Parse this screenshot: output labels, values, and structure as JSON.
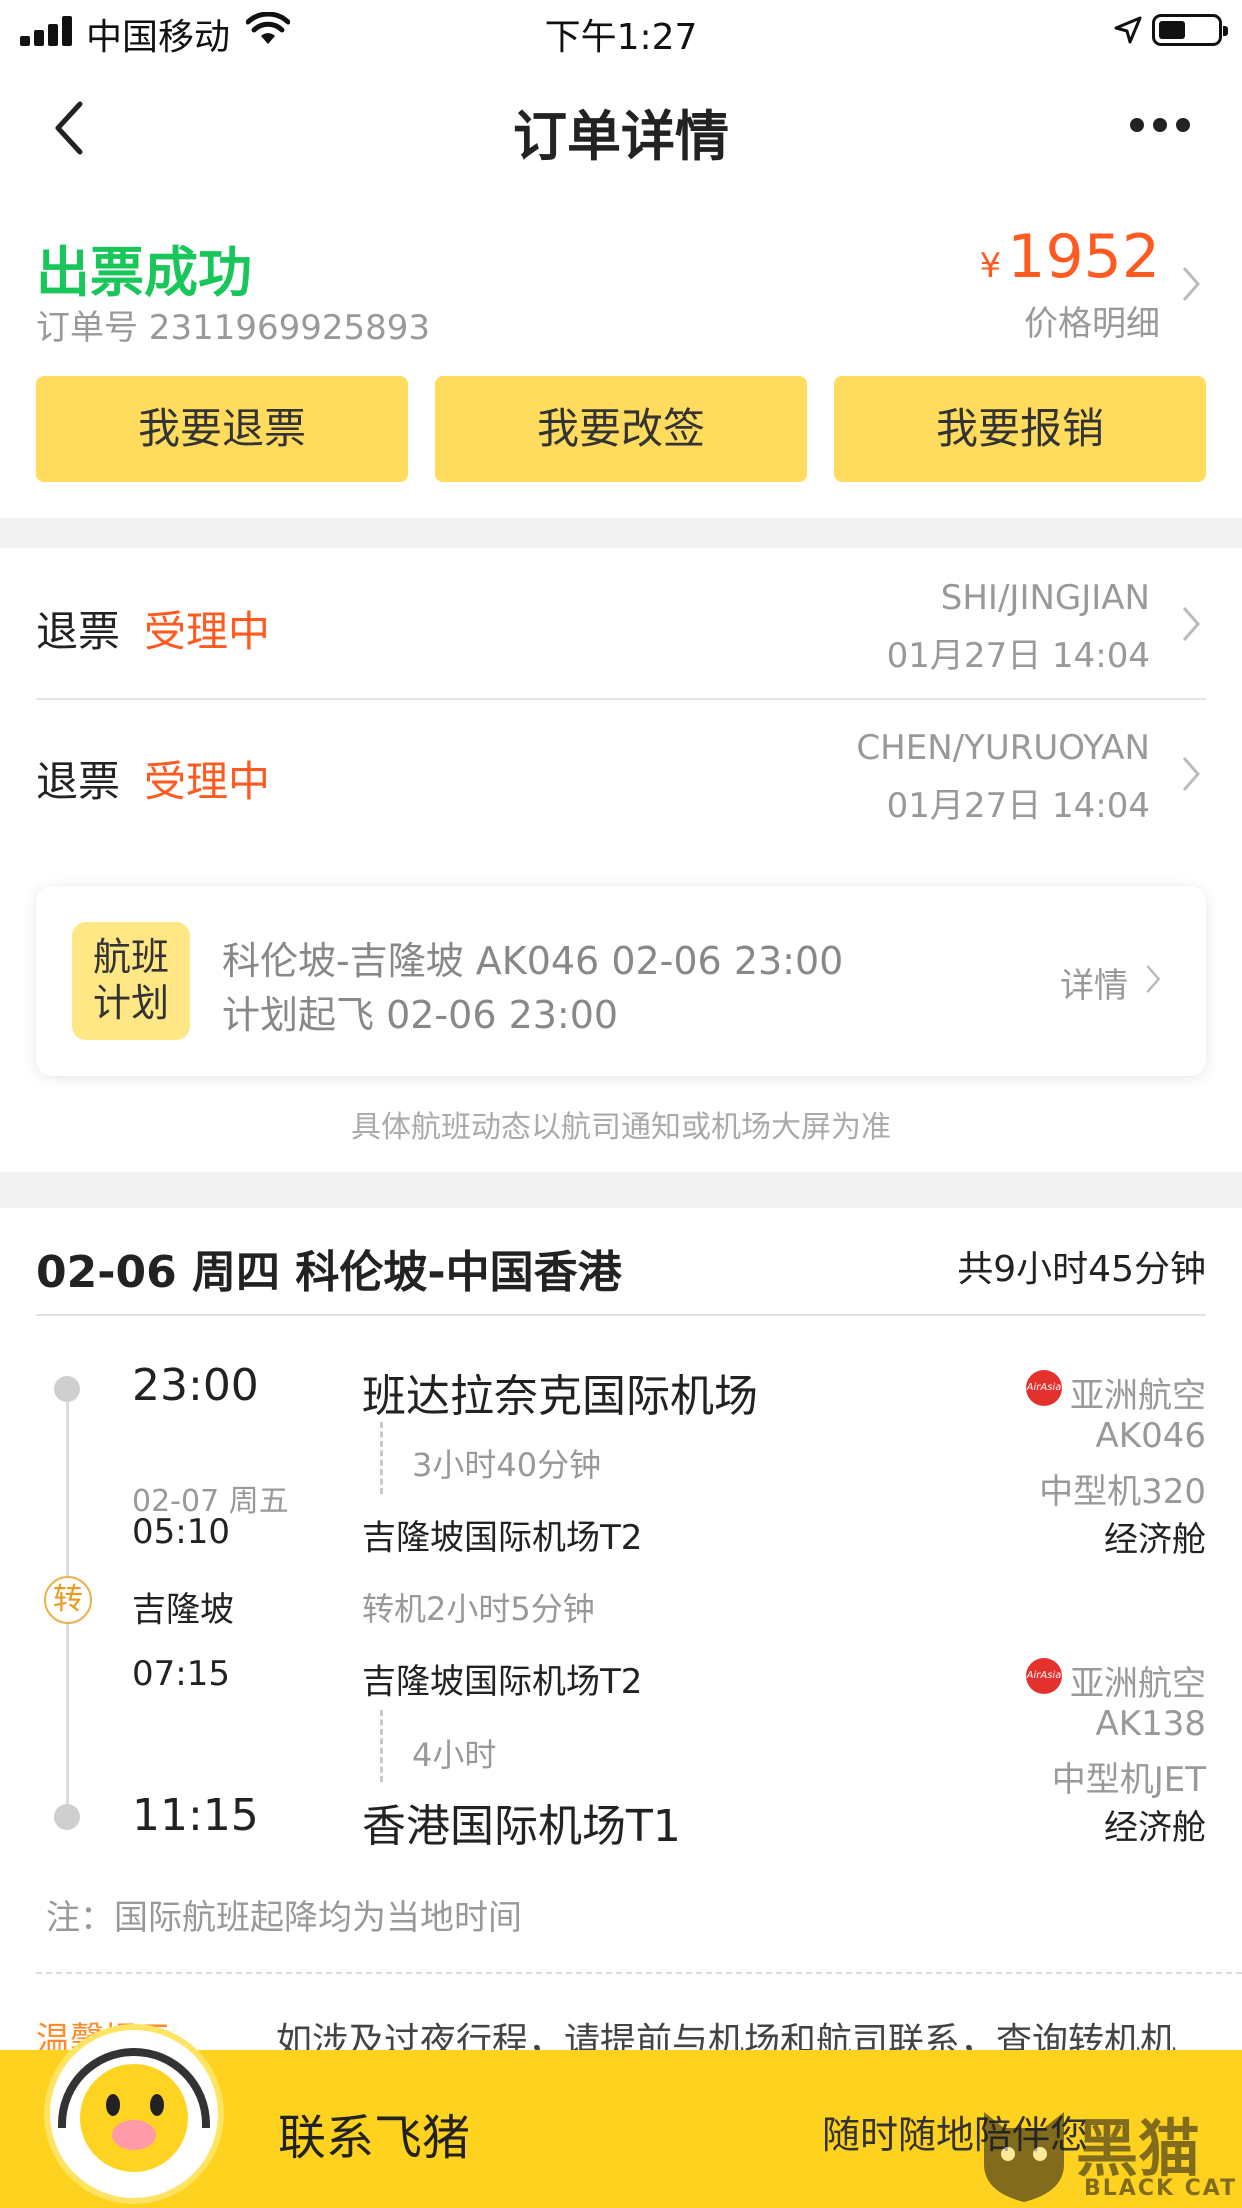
{
  "status_bar": {
    "carrier": "中国移动",
    "time": "下午1:27"
  },
  "nav": {
    "title": "订单详情"
  },
  "order": {
    "status": "出票成功",
    "order_number": "订单号 2311969925893",
    "currency": "¥",
    "price": "1952",
    "price_detail_label": "价格明细"
  },
  "actions": [
    {
      "label": "我要退票"
    },
    {
      "label": "我要改签"
    },
    {
      "label": "我要报销"
    }
  ],
  "refunds": [
    {
      "label": "退票",
      "status": "受理中",
      "passenger": "SHI/JINGJIAN",
      "time": "01月27日 14:04"
    },
    {
      "label": "退票",
      "status": "受理中",
      "passenger": "CHEN/YURUOYAN",
      "time": "01月27日 14:04"
    }
  ],
  "flight_plan": {
    "badge": [
      "航班",
      "计划"
    ],
    "line1": "科伦坡-吉隆坡 AK046 02-06 23:00",
    "line2": "计划起飞 02-06 23:00",
    "detail": "详情",
    "note": "具体航班动态以航司通知或机场大屏为准"
  },
  "itinerary": {
    "title": "02-06 周四 科伦坡-中国香港",
    "total": "共9小时45分钟",
    "transfer_badge": "转",
    "segments": [
      {
        "dep_time": "23:00",
        "dep_airport": "班达拉奈克国际机场",
        "duration": "3小时40分钟",
        "arr_date": "02-07 周五",
        "arr_time": "05:10",
        "arr_airport": "吉隆坡国际机场T2",
        "airline": "亚洲航空",
        "airline_logo": "AirAsia",
        "flight_no": "AK046",
        "aircraft": "中型机320",
        "cabin": "经济舱"
      },
      {
        "dep_time": "07:15",
        "dep_airport": "吉隆坡国际机场T2",
        "duration": "4小时",
        "arr_time": "11:15",
        "arr_airport": "香港国际机场T1",
        "airline": "亚洲航空",
        "airline_logo": "AirAsia",
        "flight_no": "AK138",
        "aircraft": "中型机JET",
        "cabin": "经济舱"
      }
    ],
    "transfer_city": "吉隆坡",
    "transfer_time": "转机2小时5分钟",
    "note": "注：国际航班起降均为当地时间"
  },
  "tip": {
    "label": "温馨提示",
    "text": "如涉及过夜行程，请提前与机场和航司联系，查询转机机"
  },
  "bottom_bar": {
    "contact": "联系飞猪",
    "subtitle": "随时随地陪伴您"
  },
  "watermark": {
    "text": "黑猫",
    "sub": "BLACK CAT"
  },
  "colors": {
    "success": "#19c65a",
    "accent_orange": "#ff5a1f",
    "button_yellow": "#ffdb5e",
    "bottom_yellow": "#ffd21f"
  }
}
